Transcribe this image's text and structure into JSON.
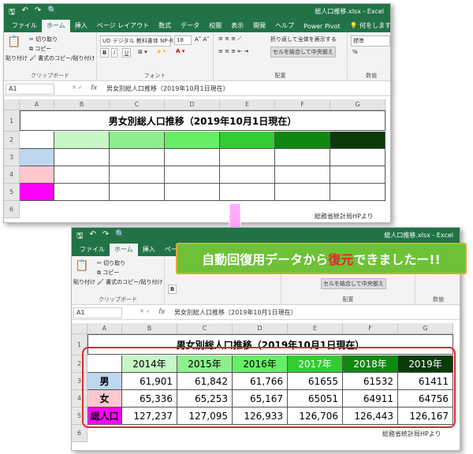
{
  "ribbon_tabs": [
    "ファイル",
    "ホーム",
    "挿入",
    "ページ レイアウト",
    "数式",
    "データ",
    "校閲",
    "表示",
    "開発",
    "ヘルプ",
    "Power Pivot"
  ],
  "tell_me": "何をしますか",
  "filename": "総人口推移.xlsx - Excel",
  "clipboard": {
    "paste": "貼り付け",
    "cut": "切り取り",
    "copy": "コピー",
    "format_painter": "書式のコピー/貼り付け",
    "label": "クリップボード"
  },
  "font": {
    "name": "UD デジタル 教科書体 NP-R",
    "size": "18",
    "bold": "B",
    "italic": "I",
    "underline": "U",
    "label": "フォント"
  },
  "align": {
    "wrap": "折り返して全体を表示する",
    "merge": "セルを結合して中央揃え",
    "label": "配置"
  },
  "number": {
    "format": "標準",
    "label": "数値",
    "percent": "%"
  },
  "namebox": "A1",
  "formula": "男女別総人口推移（2019年10月1日現在）",
  "columns": [
    "A",
    "B",
    "C",
    "D",
    "E",
    "F",
    "G"
  ],
  "rows": [
    "1",
    "2",
    "3",
    "4",
    "5",
    "6"
  ],
  "table_title": "男女別総人口推移（2019年10月1日現在）",
  "source_note": "総務省統計局HPより",
  "years": [
    "2014年",
    "2015年",
    "2016年",
    "2017年",
    "2018年",
    "2019年"
  ],
  "row_labels": [
    "男",
    "女",
    "総人口"
  ],
  "values": [
    [
      "61,901",
      "61,842",
      "61,766",
      "61655",
      "61532",
      "61411"
    ],
    [
      "65,336",
      "65,253",
      "65,167",
      "65051",
      "64911",
      "64756"
    ],
    [
      "127,237",
      "127,095",
      "126,933",
      "126,706",
      "126,443",
      "126,167"
    ]
  ],
  "header_colors": [
    "#c6f6c6",
    "#8eee8e",
    "#66ee66",
    "#33cc33",
    "#118811",
    "#0a3a0a"
  ],
  "header_text_colors": [
    "#000000",
    "#000000",
    "#000000",
    "#ffffff",
    "#ffffff",
    "#ffffff"
  ],
  "label_colors": [
    "#bdd7ee",
    "#ffc7ce",
    "#ff00ff"
  ],
  "callout": {
    "part1": "自動回復用データから",
    "part2": "復元",
    "part3": "できましたー!!"
  }
}
